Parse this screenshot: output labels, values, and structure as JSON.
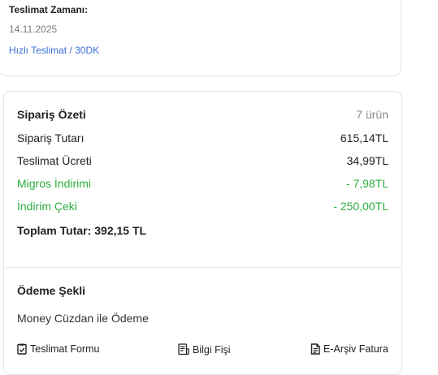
{
  "delivery": {
    "label": "Teslimat Zamanı:",
    "date": "14.11.2025",
    "type": "Hızlı Teslimat / 30DK"
  },
  "summary": {
    "title": "Sipariş Özeti",
    "item_count": "7 ürün",
    "rows": [
      {
        "label": "Sipariş Tutarı",
        "value": "615,14TL"
      },
      {
        "label": "Teslimat Ücreti",
        "value": "34,99TL"
      },
      {
        "label": "Migros İndirimi",
        "value": "- 7,98TL"
      },
      {
        "label": "İndirim Çeki",
        "value": "- 250,00TL"
      }
    ],
    "total_label": "Toplam Tutar:",
    "total_value": "392,15 TL"
  },
  "payment": {
    "title": "Ödeme Şekli",
    "method": "Money Cüzdan ile Ödeme"
  },
  "documents": [
    {
      "label": "Teslimat Formu",
      "icon": "delivery-form-icon"
    },
    {
      "label": "Bilgi Fişi",
      "icon": "receipt-icon"
    },
    {
      "label": "E-Arşiv Fatura",
      "icon": "invoice-icon"
    }
  ],
  "colors": {
    "discount": "#2cae3f",
    "link": "#3a6fd8",
    "muted": "#8a8a8a"
  }
}
